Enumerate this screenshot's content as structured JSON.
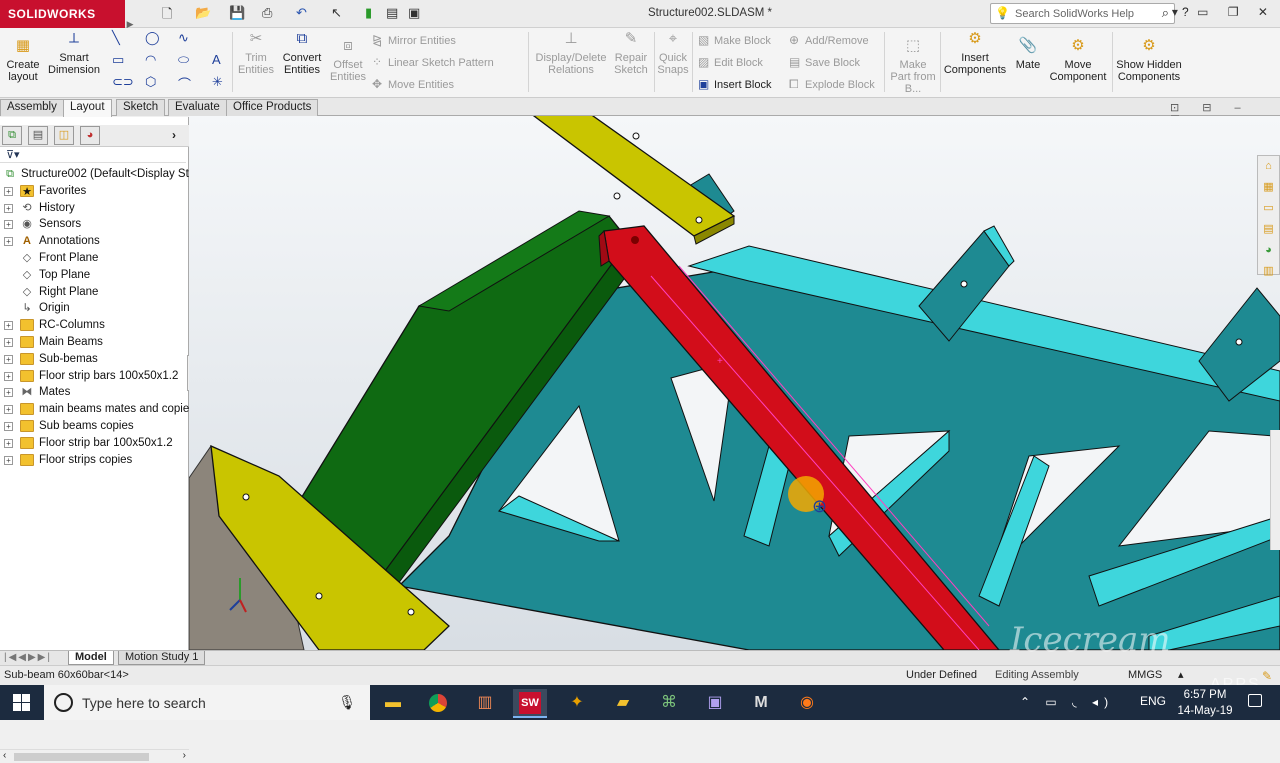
{
  "app": {
    "brand": "SOLIDWORKS",
    "document_title": "Structure002.SLDASM *",
    "search_placeholder": "Search SolidWorks Help"
  },
  "ribbon": {
    "create_layout": "Create layout",
    "smart_dimension": "Smart Dimension",
    "trim_entities": "Trim Entities",
    "convert_entities": "Convert Entities",
    "offset_entities": "Offset Entities",
    "mirror_entities": "Mirror Entities",
    "linear_sketch_pattern": "Linear Sketch Pattern",
    "move_entities": "Move Entities",
    "display_delete_relations": "Display/Delete Relations",
    "repair_sketch": "Repair Sketch",
    "quick_snaps": "Quick Snaps",
    "make_block": "Make Block",
    "edit_block": "Edit Block",
    "insert_block": "Insert Block",
    "add_remove": "Add/Remove",
    "save_block": "Save Block",
    "explode_block": "Explode Block",
    "make_part_from_block": "Make Part from B...",
    "insert_components": "Insert Components",
    "mate": "Mate",
    "move_component": "Move Component",
    "show_hidden_components": "Show Hidden Components"
  },
  "tabs": [
    "Assembly",
    "Layout",
    "Sketch",
    "Evaluate",
    "Office Products"
  ],
  "active_tab": "Layout",
  "tree": {
    "root": "Structure002  (Default<Display Sta",
    "items": [
      {
        "label": "Favorites",
        "icon": "favorites-folder-icon"
      },
      {
        "label": "History",
        "icon": "history-icon"
      },
      {
        "label": "Sensors",
        "icon": "sensors-icon"
      },
      {
        "label": "Annotations",
        "icon": "annotations-icon"
      },
      {
        "label": "Front Plane",
        "icon": "plane-icon"
      },
      {
        "label": "Top Plane",
        "icon": "plane-icon"
      },
      {
        "label": "Right Plane",
        "icon": "plane-icon"
      },
      {
        "label": "Origin",
        "icon": "origin-icon"
      },
      {
        "label": "RC-Columns",
        "icon": "folder-icon"
      },
      {
        "label": "Main Beams",
        "icon": "folder-icon"
      },
      {
        "label": "Sub-bemas",
        "icon": "folder-icon"
      },
      {
        "label": "Floor strip bars 100x50x1.2",
        "icon": "folder-icon"
      },
      {
        "label": "Mates",
        "icon": "mates-icon"
      },
      {
        "label": "main beams mates and copies",
        "icon": "folder-icon"
      },
      {
        "label": "Sub beams copies",
        "icon": "folder-icon"
      },
      {
        "label": "Floor strip bar 100x50x1.2",
        "icon": "folder-icon"
      },
      {
        "label": "Floor strips copies",
        "icon": "folder-icon"
      }
    ]
  },
  "bottom_tabs": [
    "Model",
    "Motion Study 1"
  ],
  "status": {
    "selection": "Sub-beam 60x60bar<14>",
    "state": "Under Defined",
    "mode": "Editing Assembly",
    "units": "MMGS"
  },
  "watermark": {
    "text": "Icecream",
    "sub": "APPS"
  },
  "taskbar": {
    "search_placeholder": "Type here to search",
    "language": "ENG",
    "time": "6:57 PM",
    "date": "14-May-19"
  },
  "colors": {
    "brand_red": "#c8102e",
    "teal_structure": "#1e8a92",
    "cyan_bars": "#3ed6dc",
    "yellow_plates": "#c9c500",
    "green_column": "#0f6a12",
    "red_beam": "#d20d1a"
  }
}
